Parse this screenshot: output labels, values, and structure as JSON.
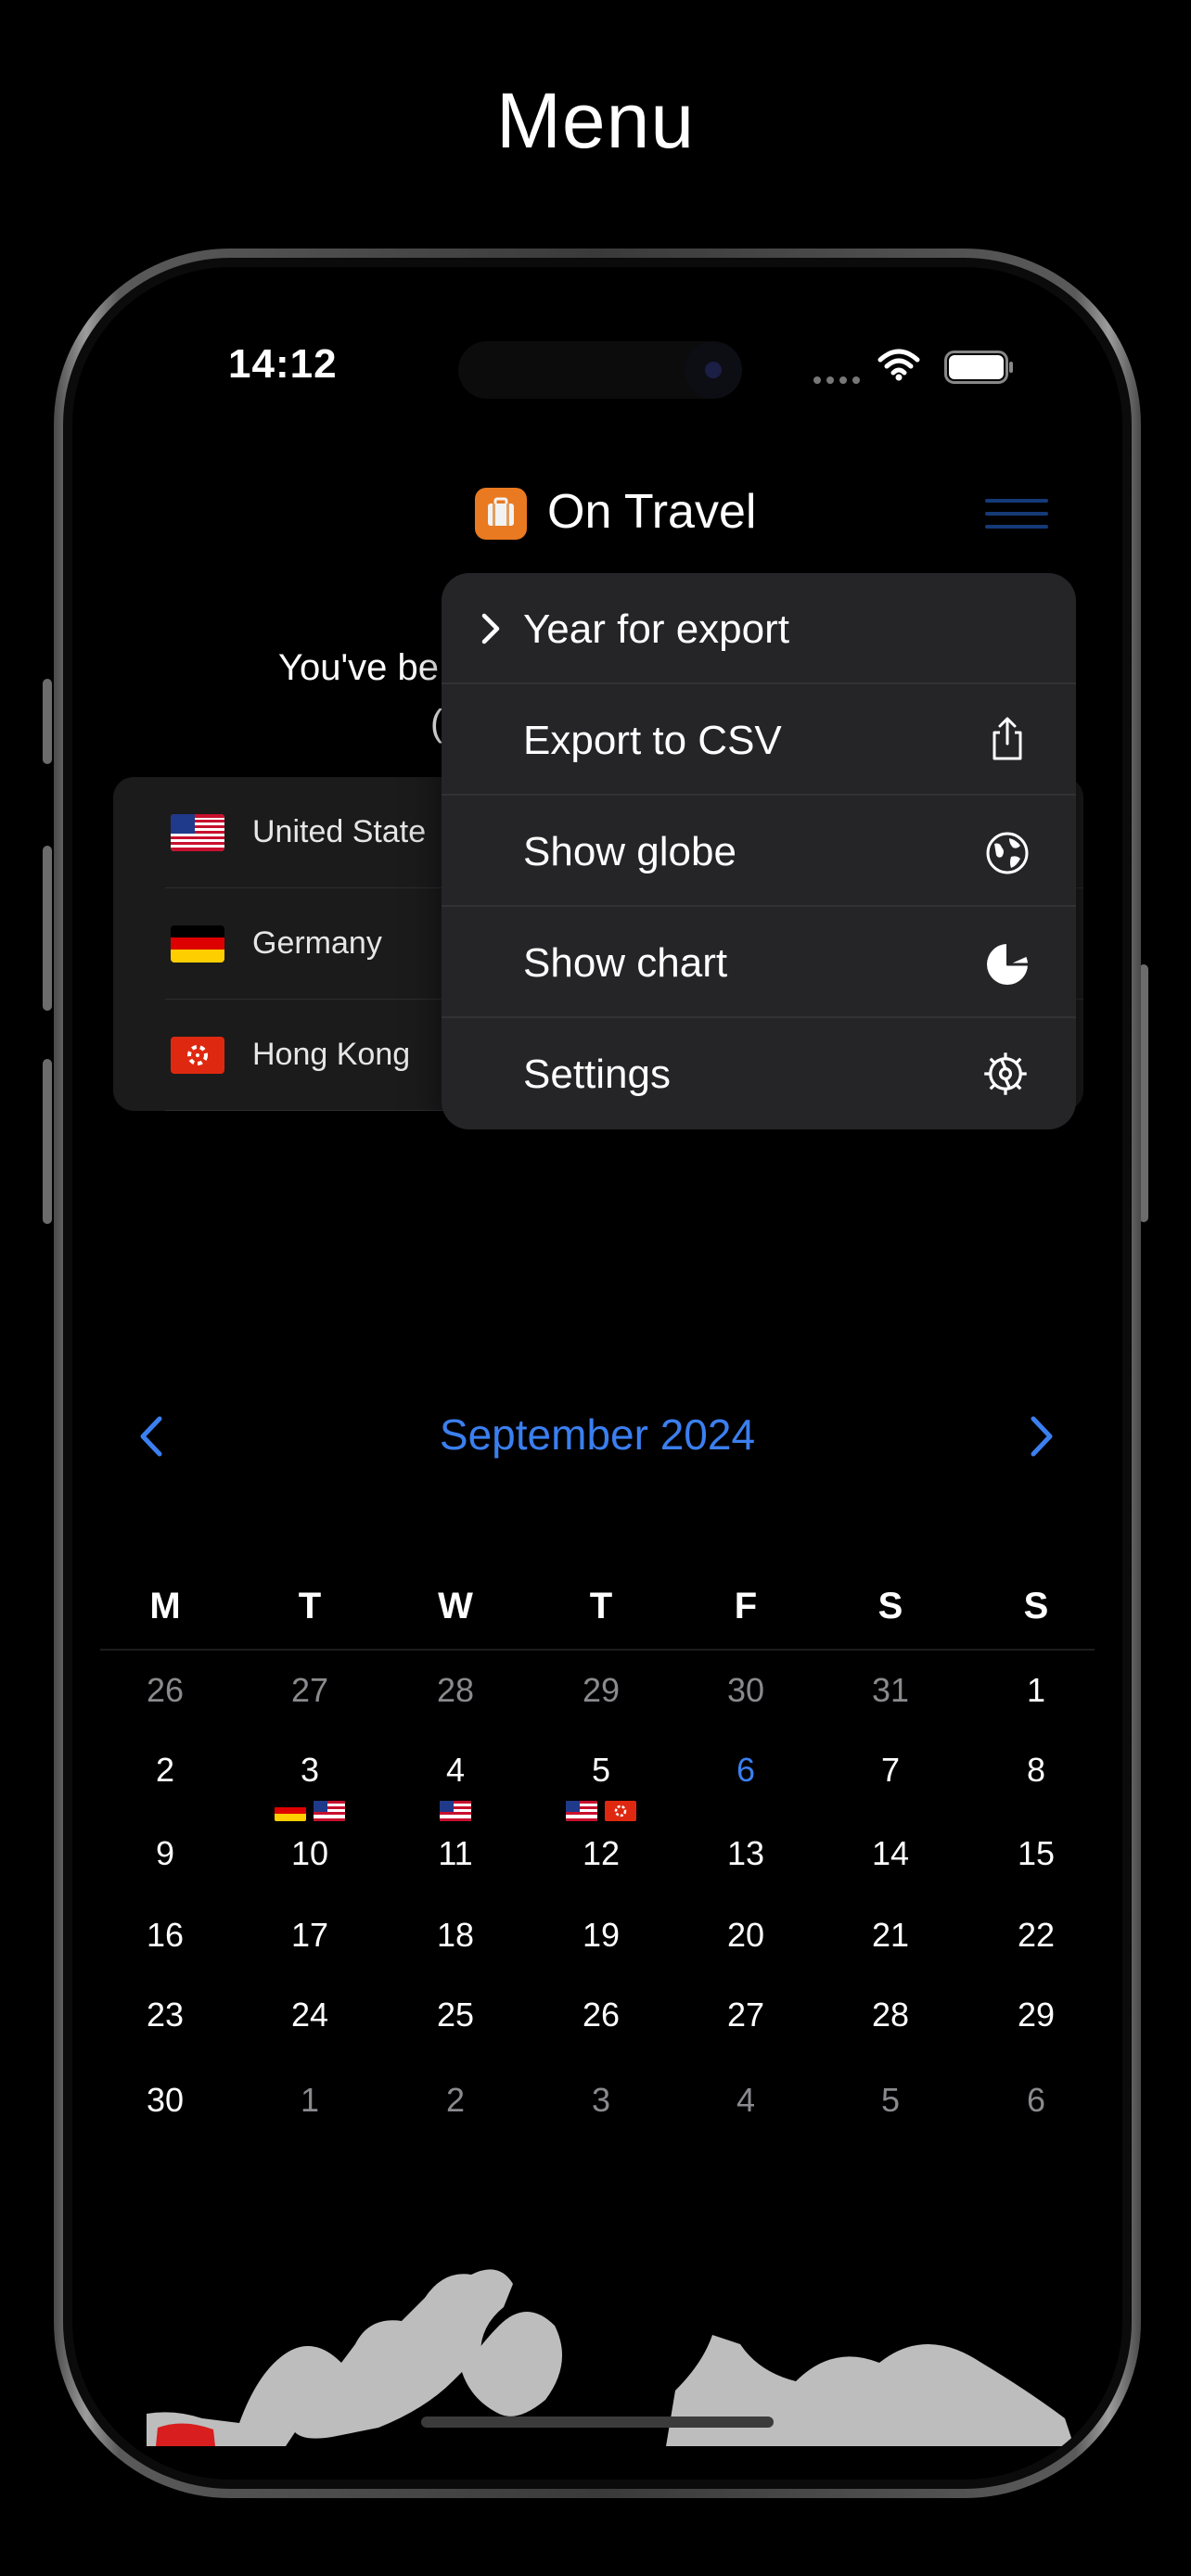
{
  "page": {
    "title": "Menu"
  },
  "status_bar": {
    "time": "14:12"
  },
  "nav": {
    "title": "On Travel"
  },
  "summary": {
    "text_prefix": "You've be",
    "text_line2_prefix": "("
  },
  "countries": [
    {
      "name": "United State",
      "flag": "us"
    },
    {
      "name": "Germany",
      "flag": "de"
    },
    {
      "name": "Hong Kong",
      "flag": "hk"
    }
  ],
  "menu": {
    "items": [
      {
        "label": "Year for export",
        "icon": "chevron-right-icon"
      },
      {
        "label": "Export to CSV",
        "icon": "share-icon"
      },
      {
        "label": "Show globe",
        "icon": "globe-icon"
      },
      {
        "label": "Show chart",
        "icon": "pie-chart-icon"
      },
      {
        "label": "Settings",
        "icon": "gear-icon"
      }
    ]
  },
  "calendar": {
    "month": "September 2024",
    "weekdays": [
      "M",
      "T",
      "W",
      "T",
      "F",
      "S",
      "S"
    ],
    "weeks": [
      [
        {
          "d": "26",
          "dim": true
        },
        {
          "d": "27",
          "dim": true
        },
        {
          "d": "28",
          "dim": true
        },
        {
          "d": "29",
          "dim": true
        },
        {
          "d": "30",
          "dim": true
        },
        {
          "d": "31",
          "dim": true
        },
        {
          "d": "1"
        }
      ],
      [
        {
          "d": "2"
        },
        {
          "d": "3",
          "flags": [
            "de",
            "us"
          ]
        },
        {
          "d": "4",
          "flags": [
            "us"
          ]
        },
        {
          "d": "5",
          "flags": [
            "us",
            "hk"
          ]
        },
        {
          "d": "6",
          "today": true
        },
        {
          "d": "7"
        },
        {
          "d": "8"
        }
      ],
      [
        {
          "d": "9"
        },
        {
          "d": "10"
        },
        {
          "d": "11"
        },
        {
          "d": "12"
        },
        {
          "d": "13"
        },
        {
          "d": "14"
        },
        {
          "d": "15"
        }
      ],
      [
        {
          "d": "16"
        },
        {
          "d": "17"
        },
        {
          "d": "18"
        },
        {
          "d": "19"
        },
        {
          "d": "20"
        },
        {
          "d": "21"
        },
        {
          "d": "22"
        }
      ],
      [
        {
          "d": "23"
        },
        {
          "d": "24"
        },
        {
          "d": "25"
        },
        {
          "d": "26"
        },
        {
          "d": "27"
        },
        {
          "d": "28"
        },
        {
          "d": "29"
        }
      ],
      [
        {
          "d": "30"
        },
        {
          "d": "1",
          "dim": true
        },
        {
          "d": "2",
          "dim": true
        },
        {
          "d": "3",
          "dim": true
        },
        {
          "d": "4",
          "dim": true
        },
        {
          "d": "5",
          "dim": true
        },
        {
          "d": "6",
          "dim": true
        }
      ]
    ]
  },
  "colors": {
    "accent": "#3b7ff0",
    "menu_bg": "#252527",
    "app_icon": "#e97a21"
  }
}
